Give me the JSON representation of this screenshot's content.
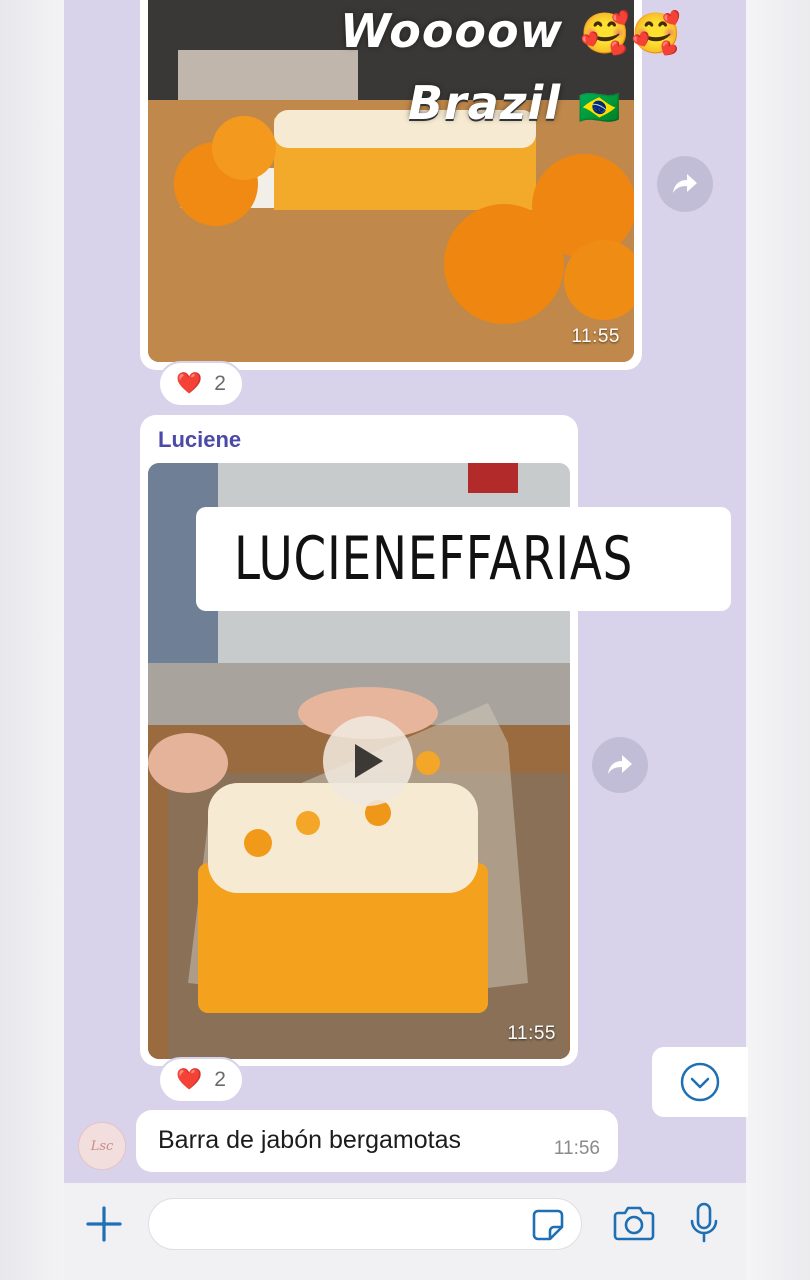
{
  "messages": [
    {
      "type": "photo",
      "overlay_line1": "Woooow",
      "overlay_line2": "Brazil",
      "overlay_emoji1": "🥰🥰",
      "overlay_emoji2": "🇧🇷",
      "time": "11:55",
      "reaction": {
        "emoji": "❤️",
        "count": "2"
      }
    },
    {
      "type": "video",
      "sender": "Luciene",
      "instagram_tag": "LUCIENEFFARIAS",
      "time": "11:55",
      "reaction": {
        "emoji": "❤️",
        "count": "2"
      }
    },
    {
      "type": "text",
      "text": "Barra de jabón bergamotas",
      "time": "11:56",
      "avatar_label": "Lsc"
    }
  ],
  "composer": {
    "placeholder": ""
  },
  "colors": {
    "chat_background": "#d8d2ea",
    "accent_blue": "#1f6fb5",
    "sender_name": "#4b4aa8"
  }
}
